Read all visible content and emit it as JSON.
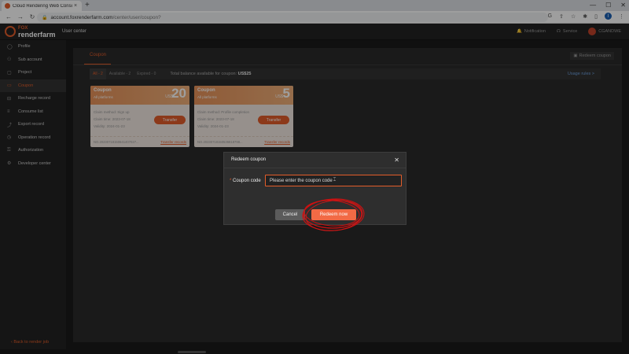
{
  "browser": {
    "tab_title": "Cloud Rendering Web Console -",
    "tab_close": "×",
    "new_tab": "+",
    "win_min": "—",
    "win_max": "☐",
    "win_close": "✕",
    "back": "←",
    "forward": "→",
    "reload": "↻",
    "url_domain": "account.foxrenderfarm.com",
    "url_path": "/center/user/coupon?",
    "profile_initial": "I"
  },
  "header": {
    "logo_top": "FOX",
    "logo_bottom": "renderfarm",
    "title": "User center",
    "notification": "Notification",
    "service": "Service",
    "username": "CGANDWE"
  },
  "sidebar": {
    "items": [
      {
        "label": "Profile",
        "icon": "◯"
      },
      {
        "label": "Sub account",
        "icon": "⚇"
      },
      {
        "label": "Project",
        "icon": "▢"
      },
      {
        "label": "Coupon",
        "icon": "▭"
      },
      {
        "label": "Recharge record",
        "icon": "⊟"
      },
      {
        "label": "Consume list",
        "icon": "≡"
      },
      {
        "label": "Export record",
        "icon": "⤴"
      },
      {
        "label": "Operation record",
        "icon": "◷"
      },
      {
        "label": "Authorization",
        "icon": "⚿"
      },
      {
        "label": "Developer center",
        "icon": "⚙"
      }
    ],
    "back": "Back to render job"
  },
  "main": {
    "tab": "Coupon",
    "redeem_link": "Redeem coupon",
    "filters": {
      "all": "All - 2",
      "available": "Available - 2",
      "expired": "Expired - 0"
    },
    "balance_label": "Total balance available for coupon:",
    "balance_value": "US$25",
    "usage_rules": "Usage rules >"
  },
  "coupons": [
    {
      "title": "Coupon",
      "subtitle": "All platforms",
      "currency": "US$",
      "amount": "20",
      "claim_method": "Claim method:  Sign up",
      "claim_time": "Claim time:  2023-07-18",
      "validity": "Validity:  2024-01-23",
      "button": "Transfer",
      "number": "NO.20230718150641407027...",
      "records": "Transfer records"
    },
    {
      "title": "Coupon",
      "subtitle": "All platforms",
      "currency": "US$",
      "amount": "5",
      "claim_method": "Claim method:  Profile completion",
      "claim_time": "Claim time:  2023-07-18",
      "validity": "Validity:  2024-01-23",
      "button": "Transfer",
      "number": "NO.20230718150536818798...",
      "records": "Transfer records"
    }
  ],
  "modal": {
    "title": "Redeem coupon",
    "close": "✕",
    "label_required": "*",
    "label": "Coupon code",
    "placeholder": "Please enter the coupon code",
    "cancel": "Cancel",
    "submit": "Redeem now"
  },
  "colors": {
    "accent": "#e35d2a",
    "highlight": "#cc1111"
  }
}
